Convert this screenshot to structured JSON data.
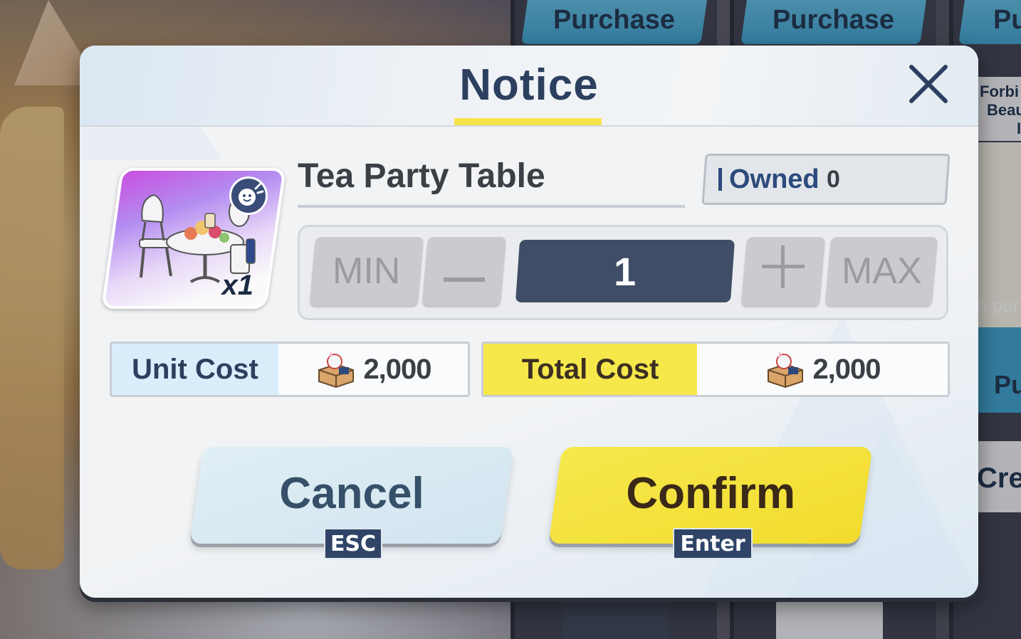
{
  "background": {
    "purchase_labels": [
      "Purchase",
      "Purchase",
      "Pu"
    ],
    "side_texts": [
      "Forbi",
      "Beau",
      "I",
      "n pur",
      "Pu",
      "Cred"
    ]
  },
  "dialog": {
    "title": "Notice",
    "close_icon": "close-icon"
  },
  "item": {
    "name": "Tea Party Table",
    "quantity_badge": "x1",
    "icon": "tea-party-table-icon",
    "owned_label": "Owned",
    "owned_value": "0"
  },
  "stepper": {
    "min_label": "MIN",
    "decrement_icon": "minus-icon",
    "value": "1",
    "increment_icon": "plus-icon",
    "max_label": "MAX"
  },
  "costs": {
    "unit_label": "Unit Cost",
    "unit_value": "2,000",
    "total_label": "Total Cost",
    "total_value": "2,000",
    "currency_icon": "furniture-coin-icon"
  },
  "actions": {
    "cancel_label": "Cancel",
    "cancel_key": "ESC",
    "confirm_label": "Confirm",
    "confirm_key": "Enter"
  },
  "colors": {
    "title": "#2c3f5e",
    "accent_yellow": "#f6e84a",
    "stepper_value_bg": "#3f4e66",
    "cancel_bg": "#d8eaf3",
    "key_hint_bg": "#2f4466"
  }
}
